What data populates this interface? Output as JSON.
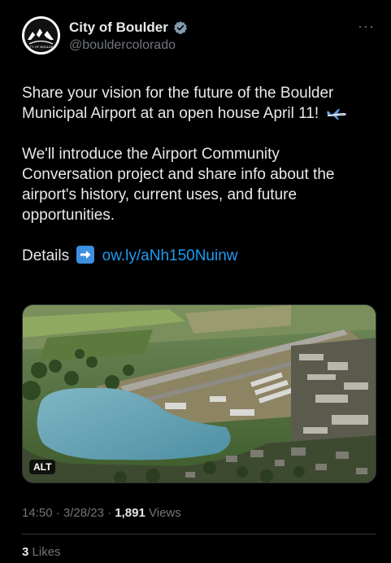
{
  "author": {
    "display_name": "City of Boulder",
    "handle": "@bouldercolorado",
    "verified": true,
    "avatar_text": "CITY OF BOULDER"
  },
  "more_label": "···",
  "tweet": {
    "paragraph_1": "Share your vision for the future of the Boulder Municipal Airport at an open house April 11!",
    "paragraph_2": "We'll introduce the Airport Community Conversation project and share info about the airport's history, current uses, and future opportunities.",
    "details_label": "Details",
    "link_text": "ow.ly/aNh150Nuinw"
  },
  "media": {
    "alt_badge": "ALT"
  },
  "meta": {
    "time": "14:50",
    "date": "3/28/23",
    "separator": "·",
    "views_count": "1,891",
    "views_label": "Views"
  },
  "likes": {
    "count": "3",
    "label": "Likes"
  },
  "colors": {
    "background": "#000000",
    "text": "#e7e9ea",
    "muted": "#71767b",
    "link": "#1d9bf0",
    "verified": "#829aab"
  }
}
